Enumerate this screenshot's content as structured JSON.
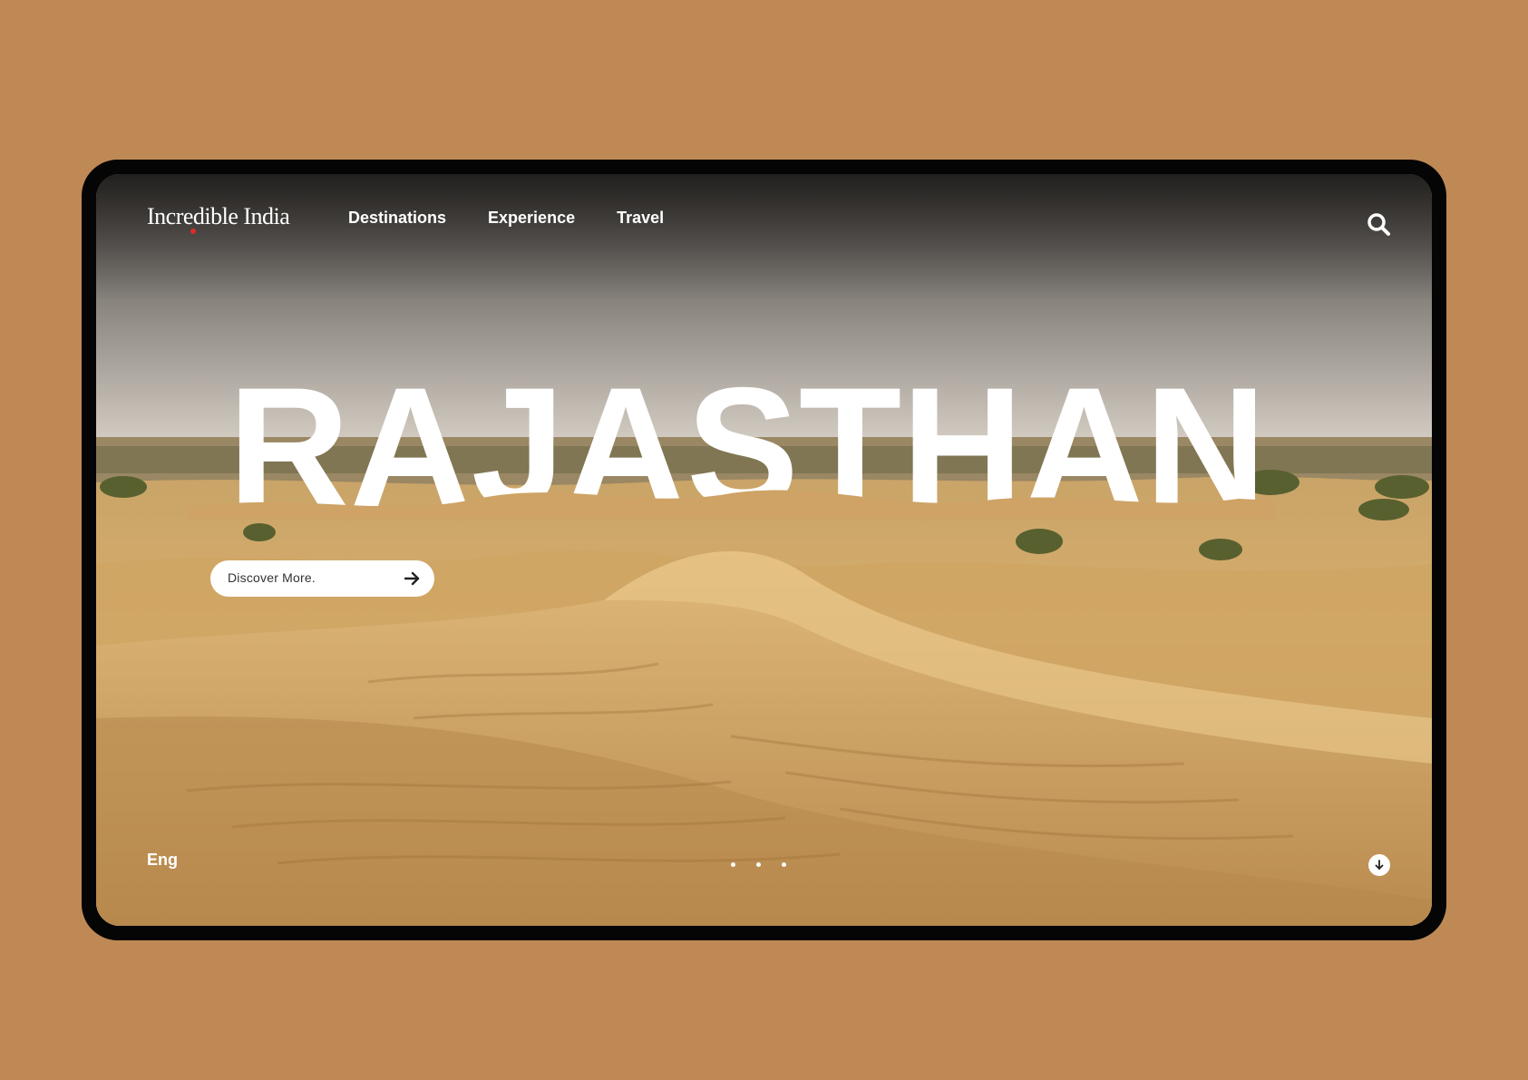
{
  "brand": {
    "logo_text": "Incredible India"
  },
  "nav": {
    "items": [
      {
        "label": "Destinations"
      },
      {
        "label": "Experience"
      },
      {
        "label": "Travel"
      }
    ]
  },
  "hero": {
    "title": "RAJASTHAN",
    "cta_label": "Discover More."
  },
  "footer": {
    "language": "Eng",
    "slide_count": 3
  },
  "colors": {
    "page_background": "#bf8956",
    "frame": "#050505",
    "text": "#ffffff",
    "logo_accent": "#e02b2b"
  },
  "icons": {
    "search": "search-icon",
    "cta_arrow": "arrow-right-icon",
    "scroll": "arrow-down-icon"
  }
}
